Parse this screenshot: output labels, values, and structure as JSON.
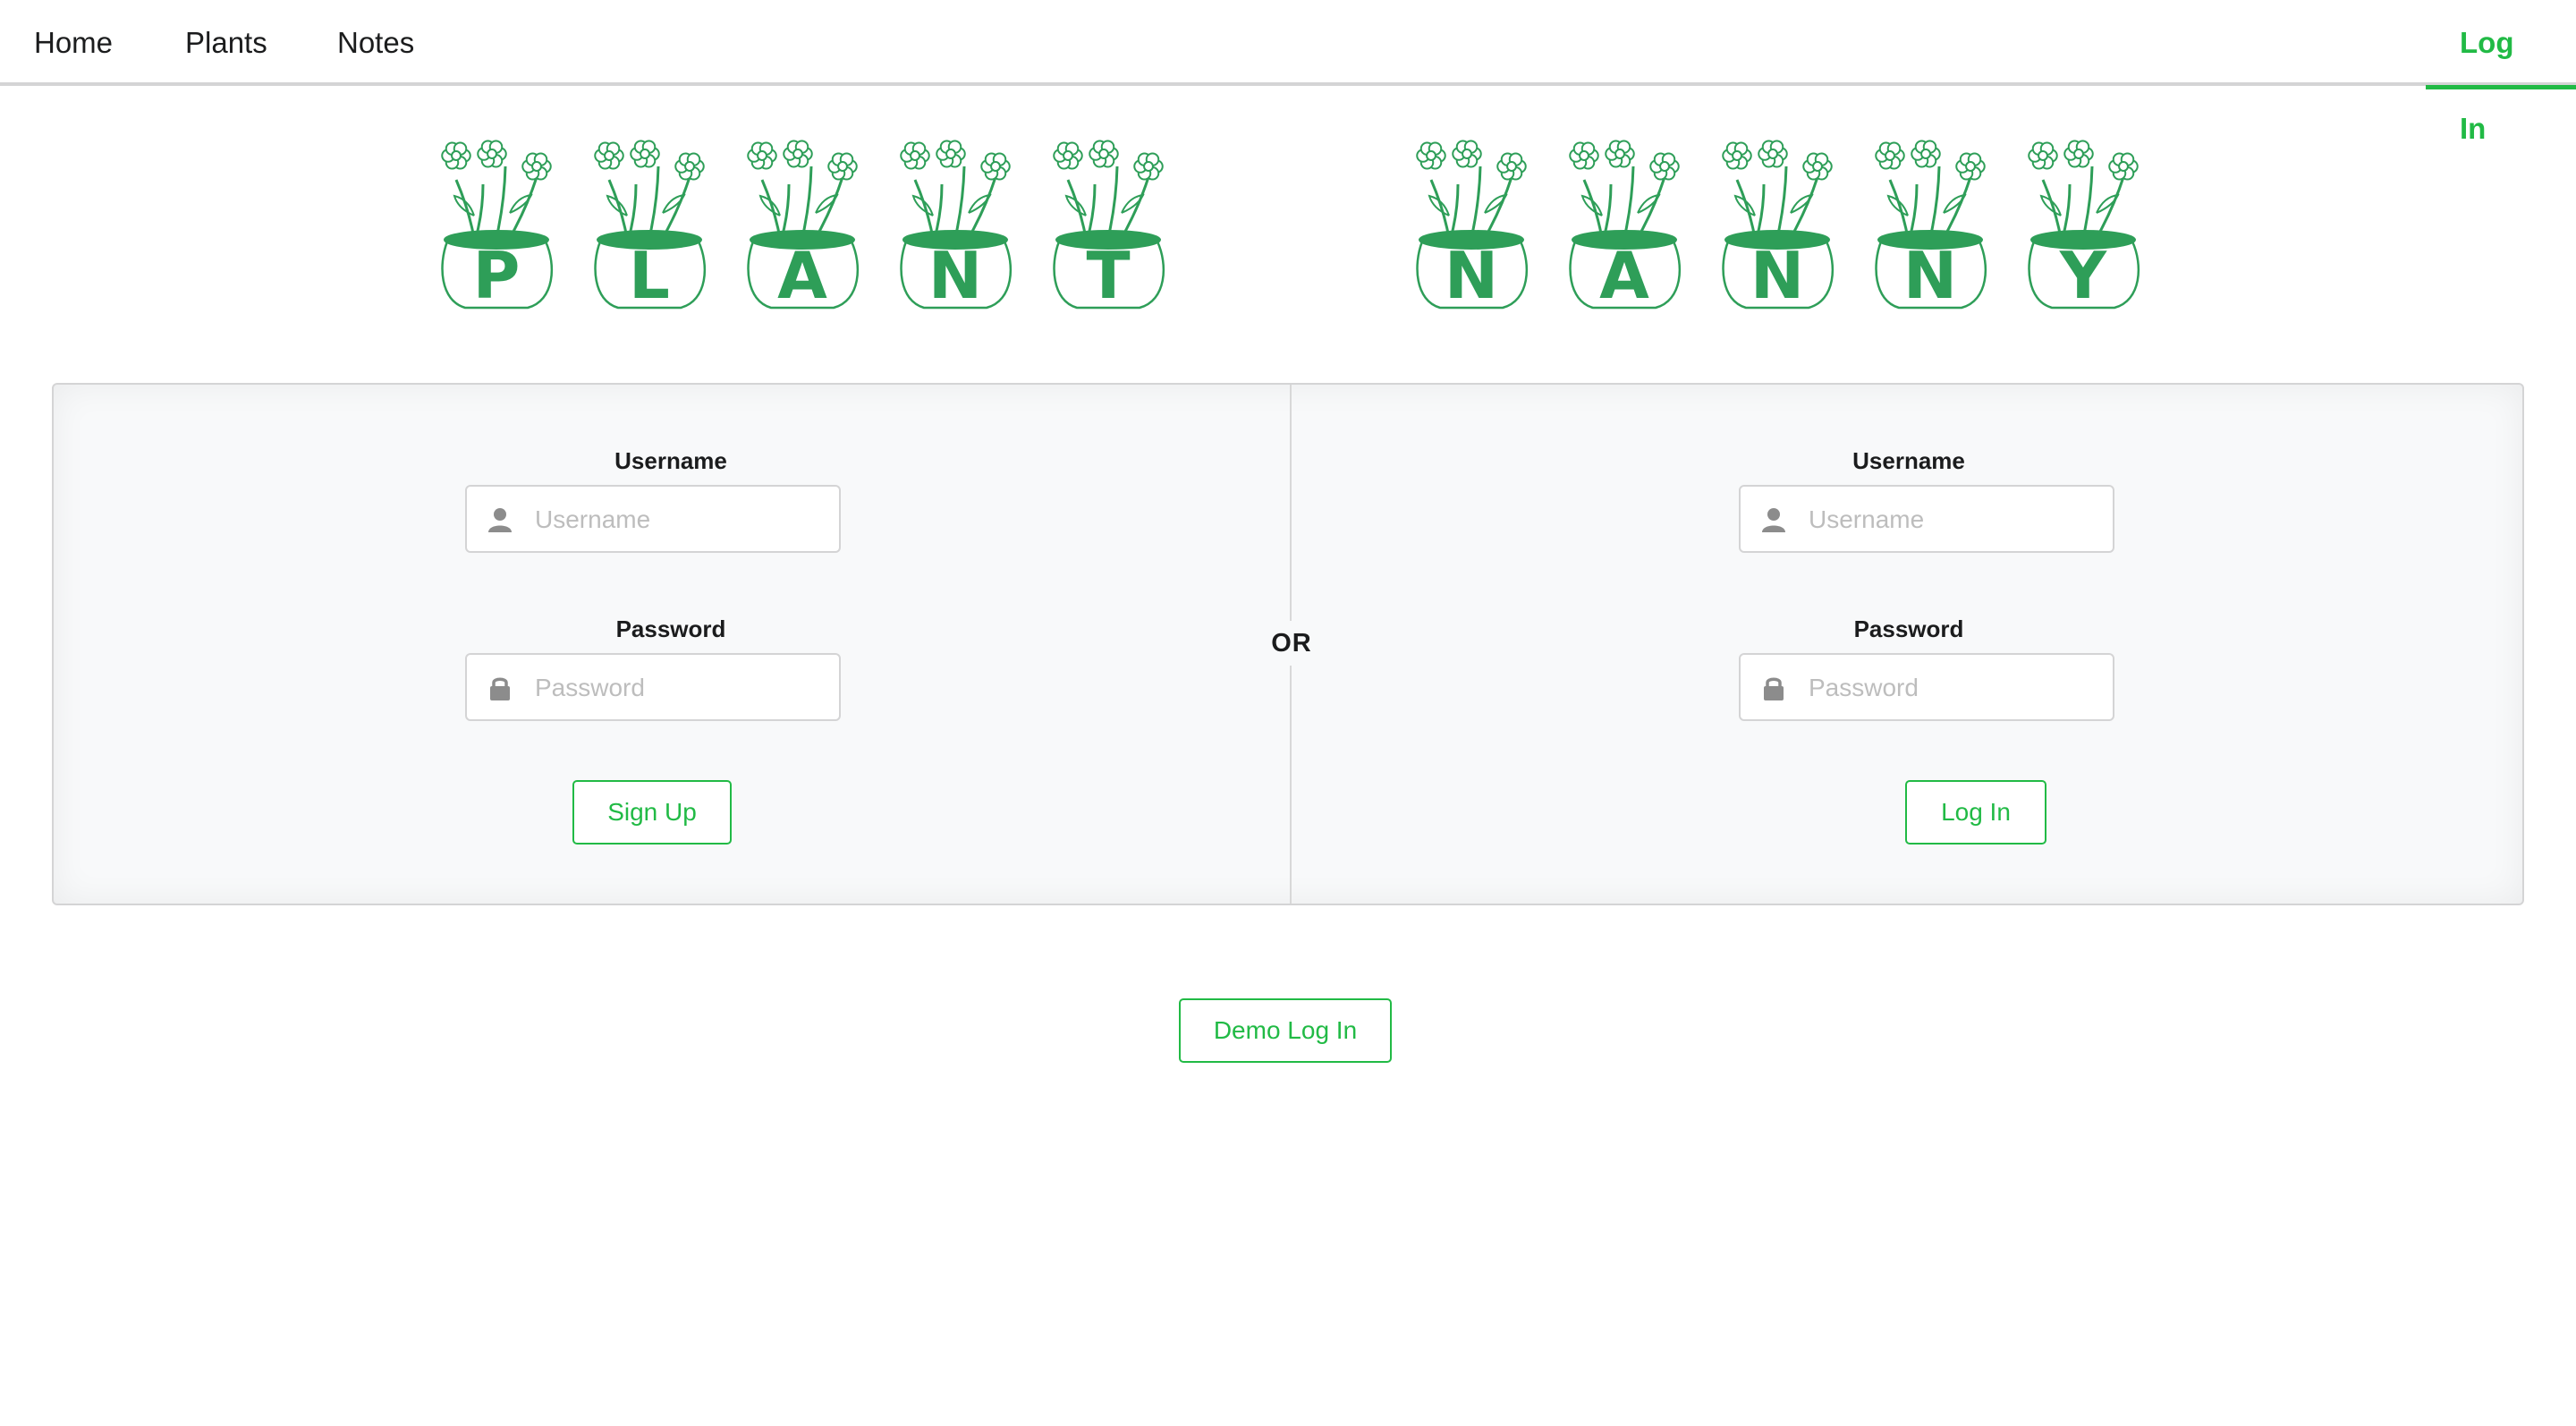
{
  "nav": {
    "items": [
      {
        "label": "Home"
      },
      {
        "label": "Plants"
      },
      {
        "label": "Notes"
      }
    ],
    "login_label": "Log In"
  },
  "logo": {
    "word1": [
      "P",
      "L",
      "A",
      "N",
      "T"
    ],
    "word2": [
      "N",
      "A",
      "N",
      "N",
      "Y"
    ],
    "color": "#2e9e58"
  },
  "signup_form": {
    "username_label": "Username",
    "username_placeholder": "Username",
    "password_label": "Password",
    "password_placeholder": "Password",
    "submit_label": "Sign Up"
  },
  "separator": "OR",
  "login_form": {
    "username_label": "Username",
    "username_placeholder": "Username",
    "password_label": "Password",
    "password_placeholder": "Password",
    "submit_label": "Log In"
  },
  "demo_button_label": "Demo Log In",
  "colors": {
    "accent": "#21ba45",
    "segment_bg": "#f8f9fa",
    "border": "#d4d4d5",
    "icon": "#8c8c8c"
  },
  "icons": {
    "username": "user-icon",
    "password": "lock-icon"
  }
}
